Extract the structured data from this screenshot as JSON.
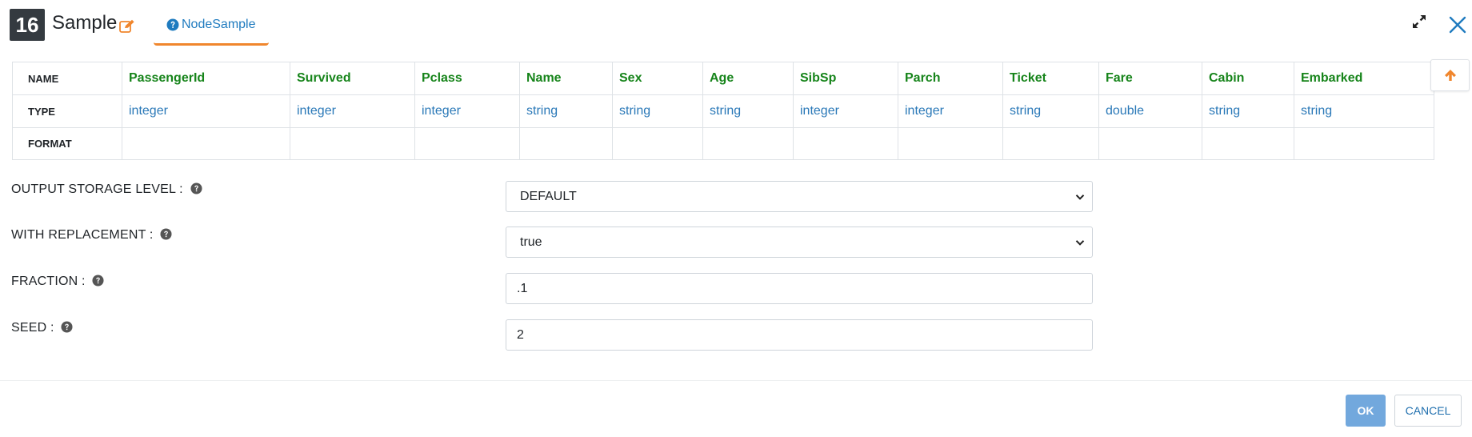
{
  "header": {
    "node_number": "16",
    "title": "Sample",
    "tab_label": "NodeSample"
  },
  "schema": {
    "row_headers": {
      "name": "NAME",
      "type": "TYPE",
      "format": "FORMAT"
    },
    "columns": [
      {
        "name": "PassengerId",
        "type": "integer",
        "format": ""
      },
      {
        "name": "Survived",
        "type": "integer",
        "format": ""
      },
      {
        "name": "Pclass",
        "type": "integer",
        "format": ""
      },
      {
        "name": "Name",
        "type": "string",
        "format": ""
      },
      {
        "name": "Sex",
        "type": "string",
        "format": ""
      },
      {
        "name": "Age",
        "type": "string",
        "format": ""
      },
      {
        "name": "SibSp",
        "type": "integer",
        "format": ""
      },
      {
        "name": "Parch",
        "type": "integer",
        "format": ""
      },
      {
        "name": "Ticket",
        "type": "string",
        "format": ""
      },
      {
        "name": "Fare",
        "type": "double",
        "format": ""
      },
      {
        "name": "Cabin",
        "type": "string",
        "format": ""
      },
      {
        "name": "Embarked",
        "type": "string",
        "format": ""
      }
    ]
  },
  "form": {
    "storage_level": {
      "label": "OUTPUT STORAGE LEVEL :",
      "value": "DEFAULT"
    },
    "with_replacement": {
      "label": "WITH REPLACEMENT :",
      "value": "true"
    },
    "fraction": {
      "label": "FRACTION :",
      "value": ".1"
    },
    "seed": {
      "label": "SEED :",
      "value": "2"
    }
  },
  "footer": {
    "ok_label": "OK",
    "cancel_label": "CANCEL"
  },
  "colors": {
    "accent_orange": "#f0862d",
    "link_blue": "#1f7bbf",
    "column_name_green": "#16841a",
    "type_blue": "#2b79b8",
    "ok_button": "#72a8dd"
  },
  "icons": [
    "pencil-square-icon",
    "question-circle-icon",
    "expand-arrows-icon",
    "close-x-icon",
    "arrow-up-icon",
    "chevron-down-icon"
  ]
}
